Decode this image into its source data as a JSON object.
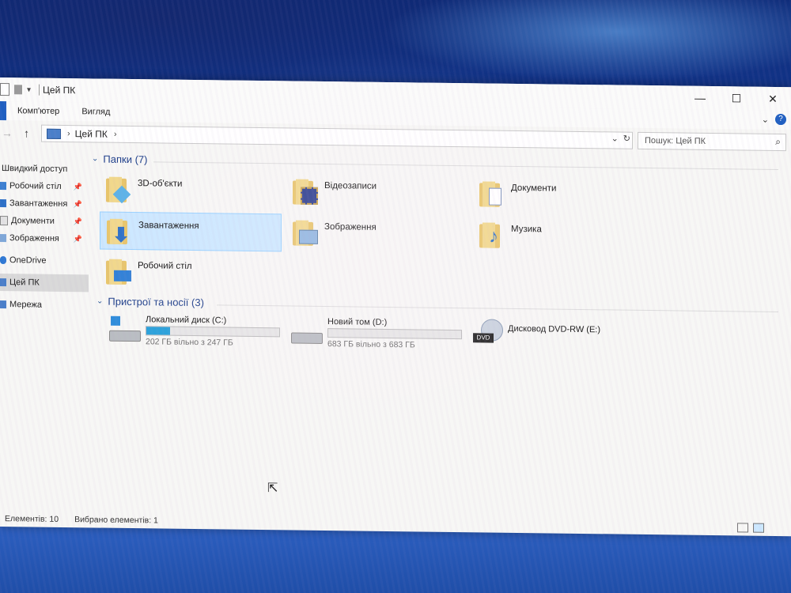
{
  "window": {
    "title": "Цей ПК",
    "controls": [
      "—",
      "☐",
      "✕"
    ]
  },
  "ribbon": {
    "tabs": [
      "Комп'ютер",
      "Вигляд"
    ],
    "help_icon": "?"
  },
  "address": {
    "location_icon": "pc-icon",
    "crumb": "Цей ПК",
    "search_placeholder": "Пошук: Цей ПК"
  },
  "sidebar": {
    "quick_access_label": "Швидкий доступ",
    "items": [
      {
        "label": "Робочий стіл",
        "pinned": true,
        "icon": "desktop-icon"
      },
      {
        "label": "Завантаження",
        "pinned": true,
        "icon": "download-icon"
      },
      {
        "label": "Документи",
        "pinned": true,
        "icon": "documents-icon"
      },
      {
        "label": "Зображення",
        "pinned": true,
        "icon": "pictures-icon"
      },
      {
        "label": "OneDrive",
        "pinned": false,
        "icon": "cloud-icon"
      },
      {
        "label": "Цей ПК",
        "pinned": false,
        "icon": "pc-icon",
        "selected": true
      },
      {
        "label": "Мережа",
        "pinned": false,
        "icon": "network-icon"
      }
    ]
  },
  "folders": {
    "header": "Папки (7)",
    "items": [
      {
        "label": "3D-об'єкти",
        "icon": "3d-objects-icon"
      },
      {
        "label": "Відеозаписи",
        "icon": "videos-icon"
      },
      {
        "label": "Документи",
        "icon": "documents-icon"
      },
      {
        "label": "Завантаження",
        "icon": "downloads-icon",
        "selected": true
      },
      {
        "label": "Зображення",
        "icon": "pictures-icon"
      },
      {
        "label": "Музика",
        "icon": "music-icon"
      },
      {
        "label": "Робочий стіл",
        "icon": "desktop-icon"
      }
    ]
  },
  "devices": {
    "header": "Пристрої та носії (3)",
    "items": [
      {
        "label": "Локальний диск (C:)",
        "free": "202 ГБ вільно з 247 ГБ",
        "used_fraction": 0.18,
        "icon": "windows-drive-icon"
      },
      {
        "label": "Новий том (D:)",
        "free": "683 ГБ вільно з 683 ГБ",
        "used_fraction": 0.0,
        "icon": "drive-icon"
      },
      {
        "label": "Дисковод DVD-RW (E:)",
        "icon": "dvd-drive-icon",
        "dvd_text": "DVD"
      }
    ]
  },
  "status": {
    "elements": "Елементів: 10",
    "selected": "Вибрано елементів: 1"
  },
  "colors": {
    "accent": "#1f5fc1",
    "selection": "#cce8ff",
    "drive_fill": "#26a0da",
    "group_header": "#1e3f8a"
  }
}
